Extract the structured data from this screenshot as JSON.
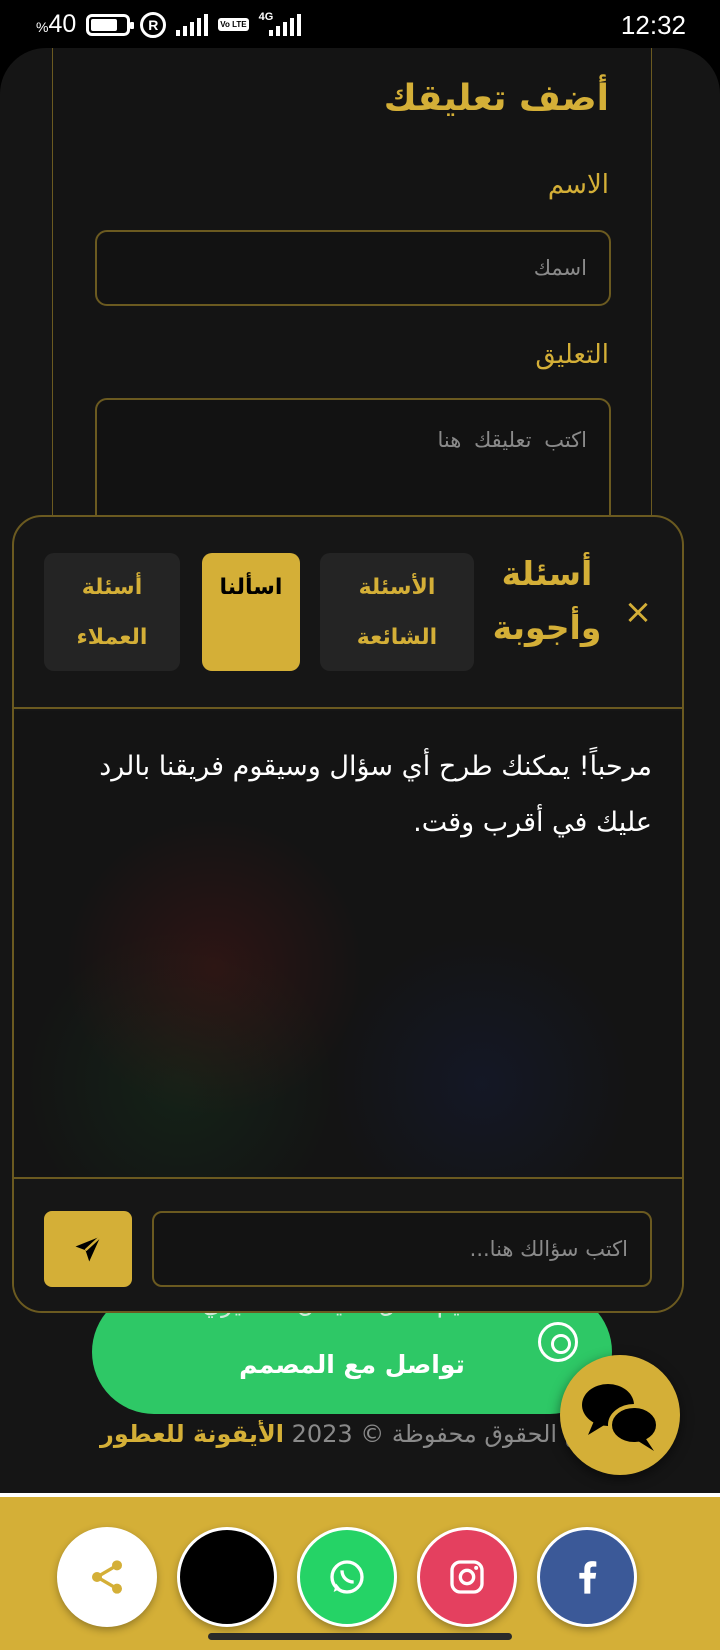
{
  "status_bar": {
    "battery_percent": "40",
    "battery_percent_sign": "%",
    "network": "4G",
    "volte": "Vo LTE",
    "reg_symbol": "R",
    "time": "12:32"
  },
  "comment_form": {
    "title": "أضف تعليقك",
    "name_label": "الاسم",
    "name_placeholder": "اسمك",
    "comment_label": "التعليق",
    "comment_placeholder": "اكتب تعليقك هنا"
  },
  "qa_modal": {
    "title": "أسئلة وأجوبة",
    "close_symbol": "×",
    "tabs": [
      {
        "label": "الأسئلة الشائعة",
        "active": false
      },
      {
        "label": "اسألنا",
        "active": true
      },
      {
        "label": "أسئلة العملاء",
        "active": false
      }
    ],
    "welcome_message": "مرحباً! يمكنك طرح أي سؤال وسيقوم فريقنا بالرد عليك في أقرب وقت.",
    "question_placeholder": "اكتب سؤالك هنا..."
  },
  "footer": {
    "designer_line1": "تصميم طلال سليمان المطيري",
    "designer_line2": "تواصل مع المصمم",
    "copyright_text": "جميع الحقوق محفوظة © 2023",
    "brand": "الأيقونة للعطور"
  },
  "bottom_bar": {
    "buttons": [
      {
        "name": "share-button",
        "icon": "share-icon",
        "color": "#ffffff"
      },
      {
        "name": "tiktok-button",
        "icon": "tiktok-icon",
        "color": "#000000"
      },
      {
        "name": "whatsapp-button",
        "icon": "whatsapp-icon",
        "color": "#25d366"
      },
      {
        "name": "instagram-button",
        "icon": "instagram-icon",
        "color": "#e4405f"
      },
      {
        "name": "facebook-button",
        "icon": "facebook-icon",
        "color": "#3b5998"
      }
    ]
  },
  "colors": {
    "accent": "#d4af37",
    "background": "#151515",
    "whatsapp_green": "#2ec866"
  }
}
